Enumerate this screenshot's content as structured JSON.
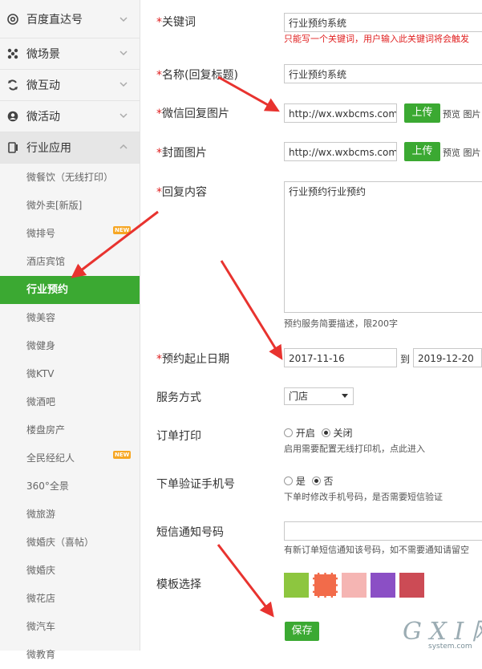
{
  "sidebar": {
    "groups": [
      {
        "label": "百度直达号",
        "icon": "at-sign-icon"
      },
      {
        "label": "微场景",
        "icon": "cluster-icon"
      },
      {
        "label": "微互动",
        "icon": "refresh-icon"
      },
      {
        "label": "微活动",
        "icon": "person-icon"
      },
      {
        "label": "行业应用",
        "icon": "mobile-icon"
      }
    ],
    "items": [
      {
        "label": "微餐饮（无线打印）"
      },
      {
        "label": "微外卖[新版]"
      },
      {
        "label": "微排号",
        "badge": "NEW"
      },
      {
        "label": "酒店宾馆"
      },
      {
        "label": "行业预约"
      },
      {
        "label": "微美容"
      },
      {
        "label": "微健身"
      },
      {
        "label": "微KTV"
      },
      {
        "label": "微酒吧"
      },
      {
        "label": "楼盘房产"
      },
      {
        "label": "全民经纪人",
        "badge": "NEW"
      },
      {
        "label": "360°全景"
      },
      {
        "label": "微旅游"
      },
      {
        "label": "微婚庆（喜帖）"
      },
      {
        "label": "微婚庆"
      },
      {
        "label": "微花店"
      },
      {
        "label": "微汽车"
      },
      {
        "label": "微教育"
      }
    ]
  },
  "form": {
    "required_mark": "*",
    "keyword": {
      "label": "关键词",
      "value": "行业预约系统",
      "hint": "只能写一个关键词，用户输入此关键词将会触发"
    },
    "name": {
      "label": "名称(回复标题)",
      "value": "行业预约系统"
    },
    "wechat_image": {
      "label": "微信回复图片",
      "value": "http://wx.wxbcms.com/",
      "upload": "上传",
      "preview": "预览 图片"
    },
    "cover_image": {
      "label": "封面图片",
      "value": "http://wx.wxbcms.com/",
      "upload": "上传",
      "preview": "预览 图片"
    },
    "content": {
      "label": "回复内容",
      "value": "行业预约行业预约",
      "hint": "预约服务简要描述，限200字"
    },
    "dates": {
      "label": "预约起止日期",
      "start": "2017-11-16",
      "sep": "到",
      "end": "2019-12-20"
    },
    "service": {
      "label": "服务方式",
      "selected": "门店"
    },
    "print": {
      "label": "订单打印",
      "on_label": "开启",
      "off_label": "关闭",
      "selected": "off",
      "hint": "启用需要配置无线打印机，点此进入"
    },
    "phone_verify": {
      "label": "下单验证手机号",
      "yes_label": "是",
      "no_label": "否",
      "selected": "no",
      "hint": "下单时修改手机号码，是否需要短信验证"
    },
    "sms": {
      "label": "短信通知号码",
      "value": "",
      "hint": "有新订单短信通知该号码，如不需要通知请留空"
    },
    "template": {
      "label": "模板选择",
      "colors": [
        "#8dc63f",
        "#f26b4a",
        "#f5b5b3",
        "#8b4fc5",
        "#cc4b55"
      ],
      "selected_index": 1
    },
    "save_label": "保存"
  },
  "watermark": {
    "brand": "G X I 网",
    "domain": "system.com"
  }
}
